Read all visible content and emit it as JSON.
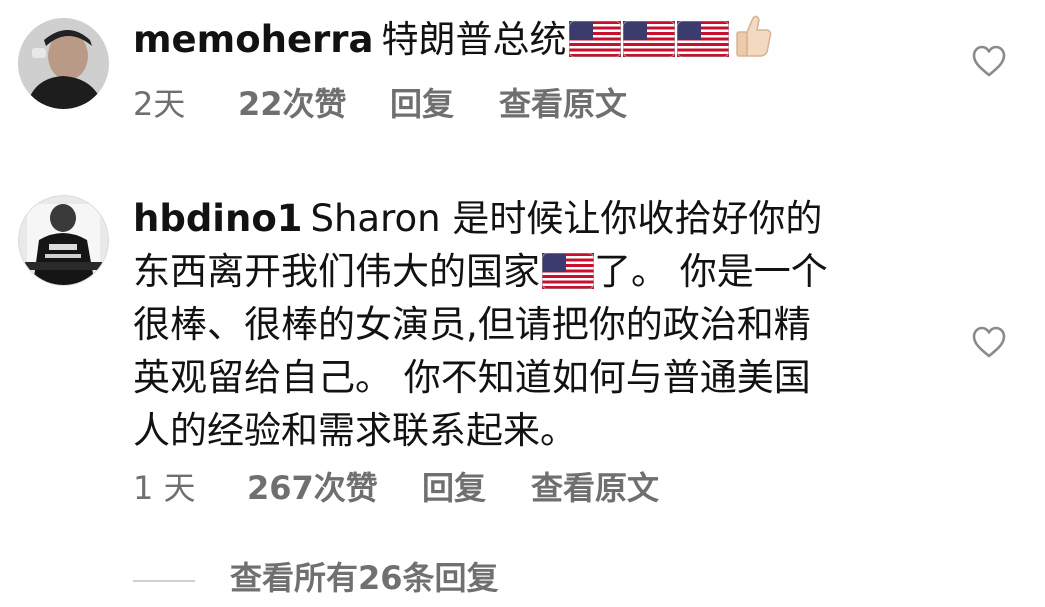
{
  "comments": [
    {
      "username": "memoherra",
      "text_before": "特朗普总统",
      "time": "2天",
      "likes": "22次赞",
      "reply": "回复",
      "view_original": "查看原文"
    },
    {
      "username": "hbdino1",
      "line1": "Sharon 是时候让你收拾好你的",
      "line2a": "东西离开我们伟大的国家",
      "line2b": "了。 你是一个",
      "line3": "很棒、很棒的女演员,但请把你的政治和精",
      "line4": "英观留给自己。 你不知道如何与普通美国",
      "line5": "人的经验和需求联系起来。",
      "time": "1 天",
      "likes": "267次赞",
      "reply": "回复",
      "view_original": "查看原文"
    }
  ],
  "view_all_replies": "查看所有26条回复",
  "icons": {
    "flag": "us-flag-icon",
    "thumbs_up": "thumbs-up-icon",
    "like": "heart-icon"
  },
  "colors": {
    "text": "#121212",
    "meta": "#6f6f6f",
    "heart": "#8a8a8a"
  }
}
